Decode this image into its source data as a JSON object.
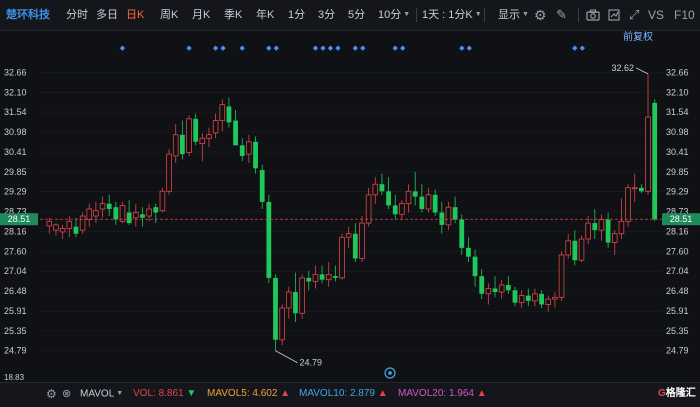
{
  "toolbar": {
    "stock_name": "楚环科技",
    "periods": [
      {
        "label": "分时",
        "active": false,
        "dropdown": false
      },
      {
        "label": "多日",
        "active": false,
        "dropdown": false
      },
      {
        "label": "日K",
        "active": true,
        "dropdown": false
      },
      {
        "label": "周K",
        "active": false,
        "dropdown": false
      },
      {
        "label": "月K",
        "active": false,
        "dropdown": false
      },
      {
        "label": "季K",
        "active": false,
        "dropdown": false
      },
      {
        "label": "年K",
        "active": false,
        "dropdown": false
      },
      {
        "label": "1分",
        "active": false,
        "dropdown": false
      },
      {
        "label": "3分",
        "active": false,
        "dropdown": false
      },
      {
        "label": "5分",
        "active": false,
        "dropdown": false
      },
      {
        "label": "10分",
        "active": false,
        "dropdown": true
      },
      {
        "label": "1天 : 1分K",
        "active": false,
        "dropdown": true
      }
    ],
    "display_label": "显示",
    "vs_label": "VS",
    "f10_label": "F10"
  },
  "chart": {
    "fq_label": "前复权",
    "price_axis": [
      "32.66",
      "32.10",
      "31.54",
      "30.98",
      "30.41",
      "29.85",
      "29.29",
      "28.73",
      "28.16",
      "27.60",
      "27.04",
      "26.48",
      "25.91",
      "25.35",
      "24.79"
    ],
    "current_price": "28.51",
    "bottom_tick": "18.83",
    "high_label": "32.62",
    "low_label": "24.79",
    "up_color": "#e0464a",
    "down_color": "#1fc85b"
  },
  "chart_data": {
    "type": "candlestick",
    "ylim": [
      24.5,
      32.9
    ],
    "current_price": 28.51,
    "max": 32.62,
    "min": 24.79,
    "candles": [
      {
        "o": 28.32,
        "h": 28.55,
        "l": 28.1,
        "c": 28.45
      },
      {
        "o": 28.2,
        "h": 28.4,
        "l": 28.05,
        "c": 28.35
      },
      {
        "o": 28.15,
        "h": 28.35,
        "l": 27.95,
        "c": 28.25
      },
      {
        "o": 28.25,
        "h": 28.6,
        "l": 28.0,
        "c": 28.45
      },
      {
        "o": 28.3,
        "h": 28.55,
        "l": 28.0,
        "c": 28.1
      },
      {
        "o": 28.2,
        "h": 28.7,
        "l": 28.1,
        "c": 28.6
      },
      {
        "o": 28.5,
        "h": 28.95,
        "l": 28.3,
        "c": 28.8
      },
      {
        "o": 28.6,
        "h": 29.0,
        "l": 28.4,
        "c": 28.75
      },
      {
        "o": 28.8,
        "h": 29.15,
        "l": 28.55,
        "c": 28.95
      },
      {
        "o": 28.95,
        "h": 29.2,
        "l": 28.6,
        "c": 28.8
      },
      {
        "o": 28.85,
        "h": 29.0,
        "l": 28.35,
        "c": 28.5
      },
      {
        "o": 28.45,
        "h": 29.0,
        "l": 28.4,
        "c": 28.9
      },
      {
        "o": 28.7,
        "h": 29.05,
        "l": 28.35,
        "c": 28.4
      },
      {
        "o": 28.55,
        "h": 28.95,
        "l": 28.3,
        "c": 28.7
      },
      {
        "o": 28.65,
        "h": 28.85,
        "l": 28.3,
        "c": 28.55
      },
      {
        "o": 28.6,
        "h": 28.95,
        "l": 28.45,
        "c": 28.8
      },
      {
        "o": 28.85,
        "h": 28.95,
        "l": 28.4,
        "c": 28.7
      },
      {
        "o": 28.75,
        "h": 29.4,
        "l": 28.7,
        "c": 29.3
      },
      {
        "o": 29.3,
        "h": 30.5,
        "l": 29.2,
        "c": 30.35
      },
      {
        "o": 30.3,
        "h": 31.2,
        "l": 30.1,
        "c": 30.9
      },
      {
        "o": 30.9,
        "h": 31.3,
        "l": 30.2,
        "c": 30.35
      },
      {
        "o": 30.4,
        "h": 31.45,
        "l": 30.3,
        "c": 31.35
      },
      {
        "o": 31.35,
        "h": 31.5,
        "l": 30.6,
        "c": 30.7
      },
      {
        "o": 30.65,
        "h": 30.95,
        "l": 30.15,
        "c": 30.8
      },
      {
        "o": 30.8,
        "h": 31.1,
        "l": 30.55,
        "c": 30.9
      },
      {
        "o": 30.95,
        "h": 31.5,
        "l": 30.8,
        "c": 31.3
      },
      {
        "o": 31.3,
        "h": 31.9,
        "l": 31.0,
        "c": 31.75
      },
      {
        "o": 31.7,
        "h": 31.95,
        "l": 31.1,
        "c": 31.25
      },
      {
        "o": 31.3,
        "h": 31.6,
        "l": 30.8,
        "c": 30.6
      },
      {
        "o": 30.6,
        "h": 30.8,
        "l": 30.15,
        "c": 30.3
      },
      {
        "o": 30.35,
        "h": 30.9,
        "l": 30.1,
        "c": 30.7
      },
      {
        "o": 30.7,
        "h": 30.85,
        "l": 29.8,
        "c": 29.95
      },
      {
        "o": 29.9,
        "h": 30.05,
        "l": 28.8,
        "c": 29.0
      },
      {
        "o": 29.0,
        "h": 29.2,
        "l": 26.7,
        "c": 26.85
      },
      {
        "o": 26.85,
        "h": 26.95,
        "l": 24.79,
        "c": 25.1
      },
      {
        "o": 25.1,
        "h": 26.1,
        "l": 24.95,
        "c": 26.0
      },
      {
        "o": 26.0,
        "h": 26.6,
        "l": 25.7,
        "c": 26.45
      },
      {
        "o": 26.45,
        "h": 27.0,
        "l": 25.6,
        "c": 25.85
      },
      {
        "o": 25.85,
        "h": 26.95,
        "l": 25.7,
        "c": 26.85
      },
      {
        "o": 26.85,
        "h": 27.05,
        "l": 26.5,
        "c": 26.75
      },
      {
        "o": 26.75,
        "h": 27.2,
        "l": 26.55,
        "c": 26.95
      },
      {
        "o": 26.95,
        "h": 27.2,
        "l": 26.7,
        "c": 26.8
      },
      {
        "o": 26.8,
        "h": 27.3,
        "l": 26.6,
        "c": 26.95
      },
      {
        "o": 26.9,
        "h": 27.2,
        "l": 26.75,
        "c": 26.85
      },
      {
        "o": 26.85,
        "h": 28.1,
        "l": 26.8,
        "c": 28.0
      },
      {
        "o": 28.0,
        "h": 28.3,
        "l": 27.7,
        "c": 28.1
      },
      {
        "o": 28.1,
        "h": 28.4,
        "l": 27.3,
        "c": 27.4
      },
      {
        "o": 27.4,
        "h": 28.6,
        "l": 27.3,
        "c": 28.4
      },
      {
        "o": 28.4,
        "h": 29.4,
        "l": 28.3,
        "c": 29.2
      },
      {
        "o": 29.2,
        "h": 29.7,
        "l": 28.95,
        "c": 29.5
      },
      {
        "o": 29.5,
        "h": 29.8,
        "l": 29.2,
        "c": 29.3
      },
      {
        "o": 29.3,
        "h": 29.7,
        "l": 28.8,
        "c": 28.9
      },
      {
        "o": 28.9,
        "h": 29.2,
        "l": 28.5,
        "c": 28.65
      },
      {
        "o": 28.65,
        "h": 29.05,
        "l": 28.5,
        "c": 28.95
      },
      {
        "o": 28.95,
        "h": 29.5,
        "l": 28.7,
        "c": 29.3
      },
      {
        "o": 29.3,
        "h": 29.85,
        "l": 28.9,
        "c": 29.15
      },
      {
        "o": 29.15,
        "h": 29.5,
        "l": 28.7,
        "c": 28.8
      },
      {
        "o": 28.8,
        "h": 29.4,
        "l": 28.7,
        "c": 29.2
      },
      {
        "o": 29.2,
        "h": 29.35,
        "l": 28.6,
        "c": 28.7
      },
      {
        "o": 28.7,
        "h": 29.0,
        "l": 28.1,
        "c": 28.35
      },
      {
        "o": 28.35,
        "h": 29.0,
        "l": 28.2,
        "c": 28.85
      },
      {
        "o": 28.85,
        "h": 29.15,
        "l": 28.4,
        "c": 28.5
      },
      {
        "o": 28.5,
        "h": 28.65,
        "l": 27.5,
        "c": 27.7
      },
      {
        "o": 27.7,
        "h": 28.0,
        "l": 27.3,
        "c": 27.45
      },
      {
        "o": 27.45,
        "h": 27.65,
        "l": 26.6,
        "c": 26.9
      },
      {
        "o": 26.9,
        "h": 27.1,
        "l": 26.25,
        "c": 26.4
      },
      {
        "o": 26.4,
        "h": 26.7,
        "l": 26.1,
        "c": 26.55
      },
      {
        "o": 26.55,
        "h": 26.9,
        "l": 26.3,
        "c": 26.45
      },
      {
        "o": 26.45,
        "h": 26.8,
        "l": 26.25,
        "c": 26.65
      },
      {
        "o": 26.65,
        "h": 26.9,
        "l": 26.4,
        "c": 26.5
      },
      {
        "o": 26.5,
        "h": 26.6,
        "l": 26.05,
        "c": 26.15
      },
      {
        "o": 26.15,
        "h": 26.5,
        "l": 26.0,
        "c": 26.35
      },
      {
        "o": 26.35,
        "h": 26.55,
        "l": 26.05,
        "c": 26.2
      },
      {
        "o": 26.2,
        "h": 26.55,
        "l": 26.05,
        "c": 26.4
      },
      {
        "o": 26.4,
        "h": 26.5,
        "l": 26.0,
        "c": 26.1
      },
      {
        "o": 26.1,
        "h": 26.35,
        "l": 25.9,
        "c": 26.25
      },
      {
        "o": 26.25,
        "h": 26.45,
        "l": 26.0,
        "c": 26.3
      },
      {
        "o": 26.3,
        "h": 27.6,
        "l": 26.2,
        "c": 27.5
      },
      {
        "o": 27.5,
        "h": 28.1,
        "l": 27.4,
        "c": 27.9
      },
      {
        "o": 27.9,
        "h": 28.2,
        "l": 27.2,
        "c": 27.35
      },
      {
        "o": 27.35,
        "h": 28.05,
        "l": 27.3,
        "c": 27.95
      },
      {
        "o": 27.95,
        "h": 28.6,
        "l": 27.8,
        "c": 28.4
      },
      {
        "o": 28.4,
        "h": 28.8,
        "l": 27.95,
        "c": 28.2
      },
      {
        "o": 28.2,
        "h": 28.65,
        "l": 27.9,
        "c": 28.5
      },
      {
        "o": 28.5,
        "h": 28.7,
        "l": 27.7,
        "c": 27.85
      },
      {
        "o": 27.85,
        "h": 28.2,
        "l": 27.5,
        "c": 28.1
      },
      {
        "o": 28.1,
        "h": 29.1,
        "l": 27.95,
        "c": 28.45
      },
      {
        "o": 28.45,
        "h": 29.5,
        "l": 28.3,
        "c": 29.4
      },
      {
        "o": 29.4,
        "h": 29.8,
        "l": 29.0,
        "c": 29.4
      },
      {
        "o": 29.4,
        "h": 29.5,
        "l": 29.25,
        "c": 29.3
      },
      {
        "o": 29.3,
        "h": 32.62,
        "l": 29.2,
        "c": 31.4
      },
      {
        "o": 31.8,
        "h": 31.9,
        "l": 28.45,
        "c": 28.51
      }
    ]
  },
  "markers": [
    {
      "idx": 11,
      "count": 1
    },
    {
      "idx": 21,
      "count": 1
    },
    {
      "idx": 25,
      "count": 2
    },
    {
      "idx": 29,
      "count": 1
    },
    {
      "idx": 33,
      "count": 2
    },
    {
      "idx": 40,
      "count": 4
    },
    {
      "idx": 46,
      "count": 2
    },
    {
      "idx": 52,
      "count": 2
    },
    {
      "idx": 62,
      "count": 2
    },
    {
      "idx": 79,
      "count": 2
    }
  ],
  "footer": {
    "indicator": "MAVOL",
    "vol_label": "VOL:",
    "vol_value": "8.861",
    "mavol5_label": "MAVOL5:",
    "mavol5_value": "4.602",
    "mavol10_label": "MAVOL10:",
    "mavol10_value": "2.879",
    "mavol20_label": "MAVOL20:",
    "mavol20_value": "1.964",
    "vol_color": "#e0464a",
    "mavol5_color": "#f0a23c",
    "mavol10_color": "#3fa7e8",
    "mavol20_color": "#d05ac8"
  },
  "watermark": "格隆汇"
}
